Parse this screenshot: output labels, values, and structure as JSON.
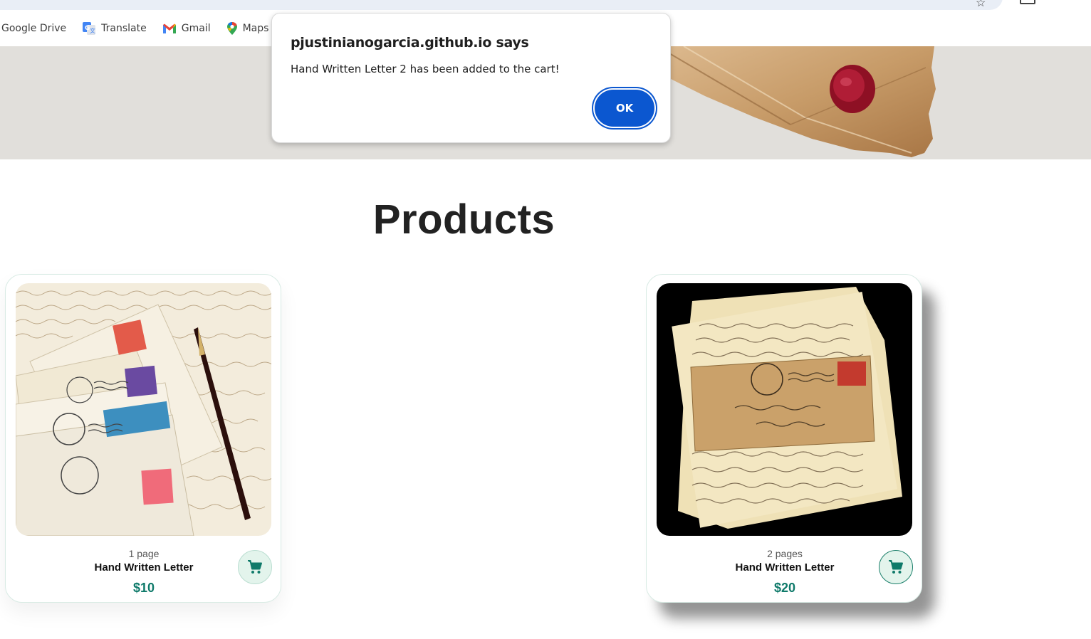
{
  "bookmarks": [
    {
      "label": "Google Drive",
      "icon": "google-drive-icon"
    },
    {
      "label": "Translate",
      "icon": "translate-icon"
    },
    {
      "label": "Gmail",
      "icon": "gmail-icon"
    },
    {
      "label": "Maps",
      "icon": "maps-icon"
    }
  ],
  "dialog": {
    "title": "pjustinianogarcia.github.io says",
    "message": "Hand Written Letter 2 has been added to the cart!",
    "ok_label": "OK"
  },
  "page": {
    "heading": "Products"
  },
  "products": [
    {
      "pages": "1 page",
      "name": "Hand Written Letter",
      "price": "$10",
      "image": "stack-of-stamped-envelopes-with-pen"
    },
    {
      "pages": "2 pages",
      "name": "Hand Written Letter",
      "price": "$20",
      "image": "old-letters-with-envelope"
    }
  ],
  "colors": {
    "accent": "#0f7a6a",
    "dialog_button": "#0b57d0",
    "hero_bg": "#e1dfdb"
  }
}
